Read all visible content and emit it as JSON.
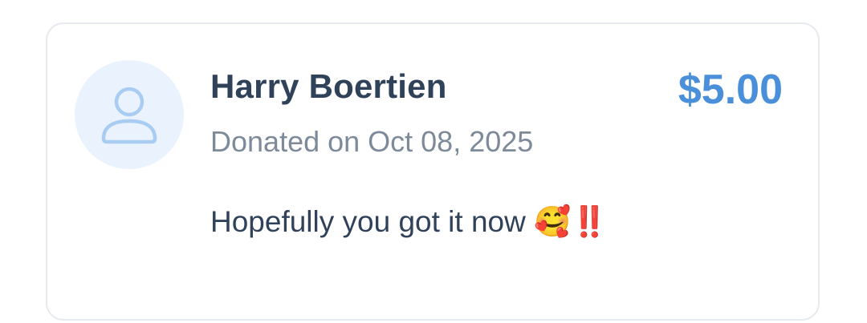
{
  "donation": {
    "donor_name": "Harry Boertien",
    "date_text": "Donated on Oct 08, 2025",
    "amount": "$5.00",
    "message": "Hopefully you got it now 🥰‼️",
    "avatar_icon": "user-icon"
  },
  "colors": {
    "name_text": "#2f425a",
    "date_text": "#7c8a99",
    "amount_text": "#4a8fda",
    "avatar_background": "#eaf3fd",
    "avatar_icon_stroke": "#a9cdf2",
    "card_border": "#e6e9ee"
  }
}
